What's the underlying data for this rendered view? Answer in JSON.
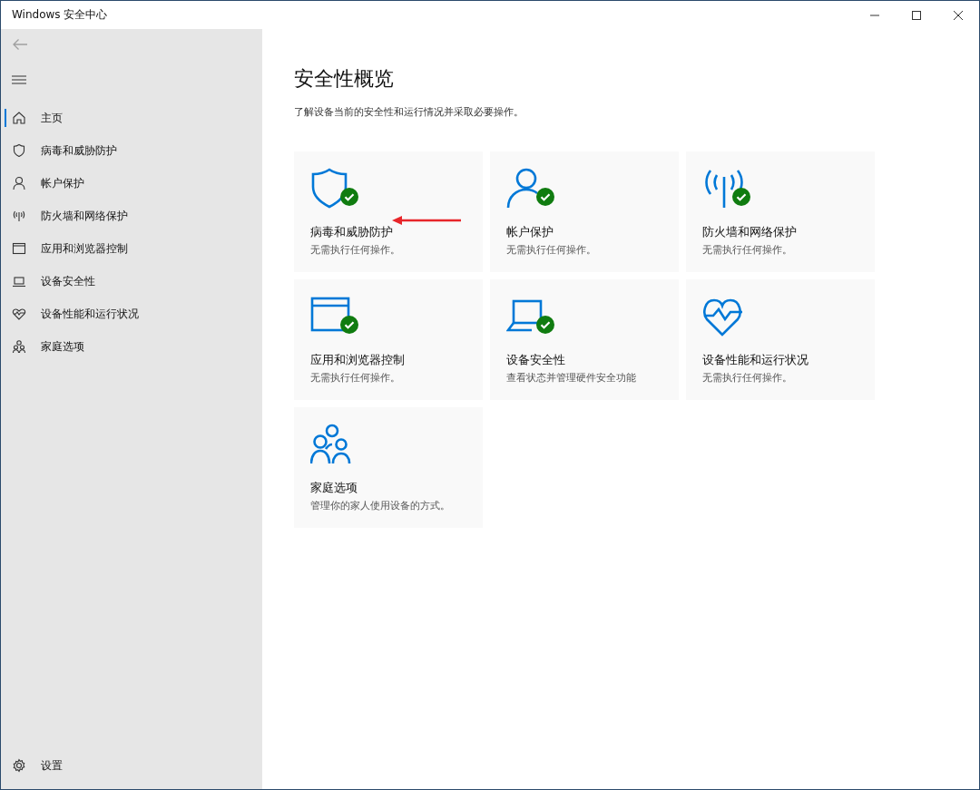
{
  "window": {
    "title": "Windows 安全中心"
  },
  "sidebar": {
    "items": [
      {
        "kind": "home",
        "label": "主页",
        "selected": true
      },
      {
        "kind": "shield",
        "label": "病毒和威胁防护",
        "selected": false
      },
      {
        "kind": "person",
        "label": "帐户保护",
        "selected": false
      },
      {
        "kind": "antenna",
        "label": "防火墙和网络保护",
        "selected": false
      },
      {
        "kind": "browser",
        "label": "应用和浏览器控制",
        "selected": false
      },
      {
        "kind": "laptop",
        "label": "设备安全性",
        "selected": false
      },
      {
        "kind": "heart",
        "label": "设备性能和运行状况",
        "selected": false
      },
      {
        "kind": "family",
        "label": "家庭选项",
        "selected": false
      }
    ],
    "settings": {
      "label": "设置"
    }
  },
  "page": {
    "title": "安全性概览",
    "subtitle": "了解设备当前的安全性和运行情况并采取必要操作。"
  },
  "cards": [
    {
      "kind": "shield",
      "ok": true,
      "title": "病毒和威胁防护",
      "status": "无需执行任何操作。"
    },
    {
      "kind": "person",
      "ok": true,
      "title": "帐户保护",
      "status": "无需执行任何操作。"
    },
    {
      "kind": "antenna",
      "ok": true,
      "title": "防火墙和网络保护",
      "status": "无需执行任何操作。"
    },
    {
      "kind": "browser",
      "ok": true,
      "title": "应用和浏览器控制",
      "status": "无需执行任何操作。"
    },
    {
      "kind": "laptop",
      "ok": true,
      "title": "设备安全性",
      "status": "查看状态并管理硬件安全功能"
    },
    {
      "kind": "heart",
      "ok": false,
      "title": "设备性能和运行状况",
      "status": "无需执行任何操作。"
    },
    {
      "kind": "family",
      "ok": false,
      "title": "家庭选项",
      "status": "管理你的家人使用设备的方式。"
    }
  ]
}
